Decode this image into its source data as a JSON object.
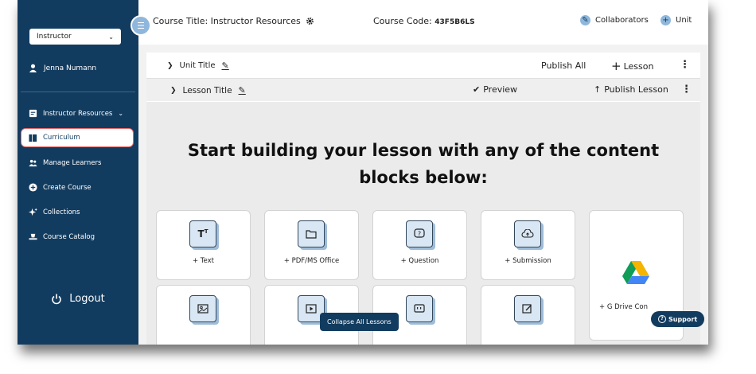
{
  "sidebar": {
    "role_select": "Instructor",
    "user_name": "Jenna Numann",
    "items": [
      {
        "label": "Instructor Resources",
        "icon": "book-open-icon"
      },
      {
        "label": "Curriculum",
        "icon": "books-icon"
      },
      {
        "label": "Manage Learners",
        "icon": "users-icon"
      },
      {
        "label": "Create Course",
        "icon": "plus-circle-icon"
      },
      {
        "label": "Collections",
        "icon": "sparkles-icon"
      },
      {
        "label": "Course Catalog",
        "icon": "hat-icon"
      }
    ],
    "logout": "Logout"
  },
  "header": {
    "course_title": "Course Title: Instructor Resources",
    "course_code_label": "Course Code:",
    "course_code_value": "43F5B6LS",
    "collaborators": "Collaborators",
    "unit": "Unit"
  },
  "unit_row": {
    "title": "Unit Title",
    "publish_all": "Publish All",
    "add_lesson": "Lesson"
  },
  "lesson_row": {
    "title": "Lesson Title",
    "preview": "Preview",
    "publish_lesson": "Publish Lesson"
  },
  "canvas": {
    "headline_1": "Start building your lesson with any of the content",
    "headline_2": "blocks below:",
    "blocks": [
      {
        "label": "+ Text"
      },
      {
        "label": "+ PDF/MS Office"
      },
      {
        "label": "+ Question"
      },
      {
        "label": "+ Submission"
      },
      {
        "label": "+ G Drive Con"
      }
    ]
  },
  "tooltip": "Collapse All Lessons",
  "support": "Support",
  "colors": {
    "sidebar": "#123c5f",
    "accent": "#8fb7dc",
    "active_outline": "#e36b6b"
  }
}
